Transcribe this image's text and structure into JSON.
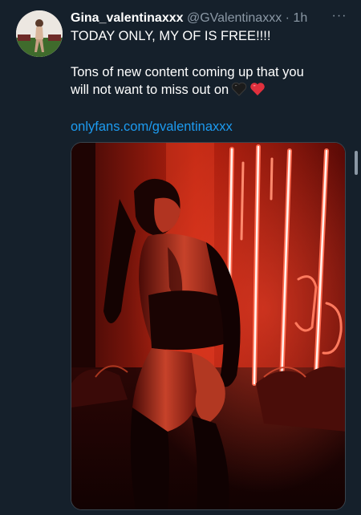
{
  "tweet": {
    "display_name": "Gina_valentinaxxx",
    "handle": "@GValentinaxxx",
    "separator": "·",
    "time": "1h",
    "more_label": "···",
    "text_line1": "TODAY ONLY, MY OF IS FREE!!!!",
    "text_line2": "Tons of new content coming up that you",
    "text_line3": "will not want to miss out on",
    "emojis": [
      "black-heart-icon",
      "red-heart-icon"
    ],
    "link": "onlyfans.com/gvalentinaxxx"
  },
  "colors": {
    "background": "#15202b",
    "primary_text": "#ffffff",
    "secondary_text": "#8b98a5",
    "link": "#1d9bf0",
    "neon_red": "#ff3a26"
  }
}
